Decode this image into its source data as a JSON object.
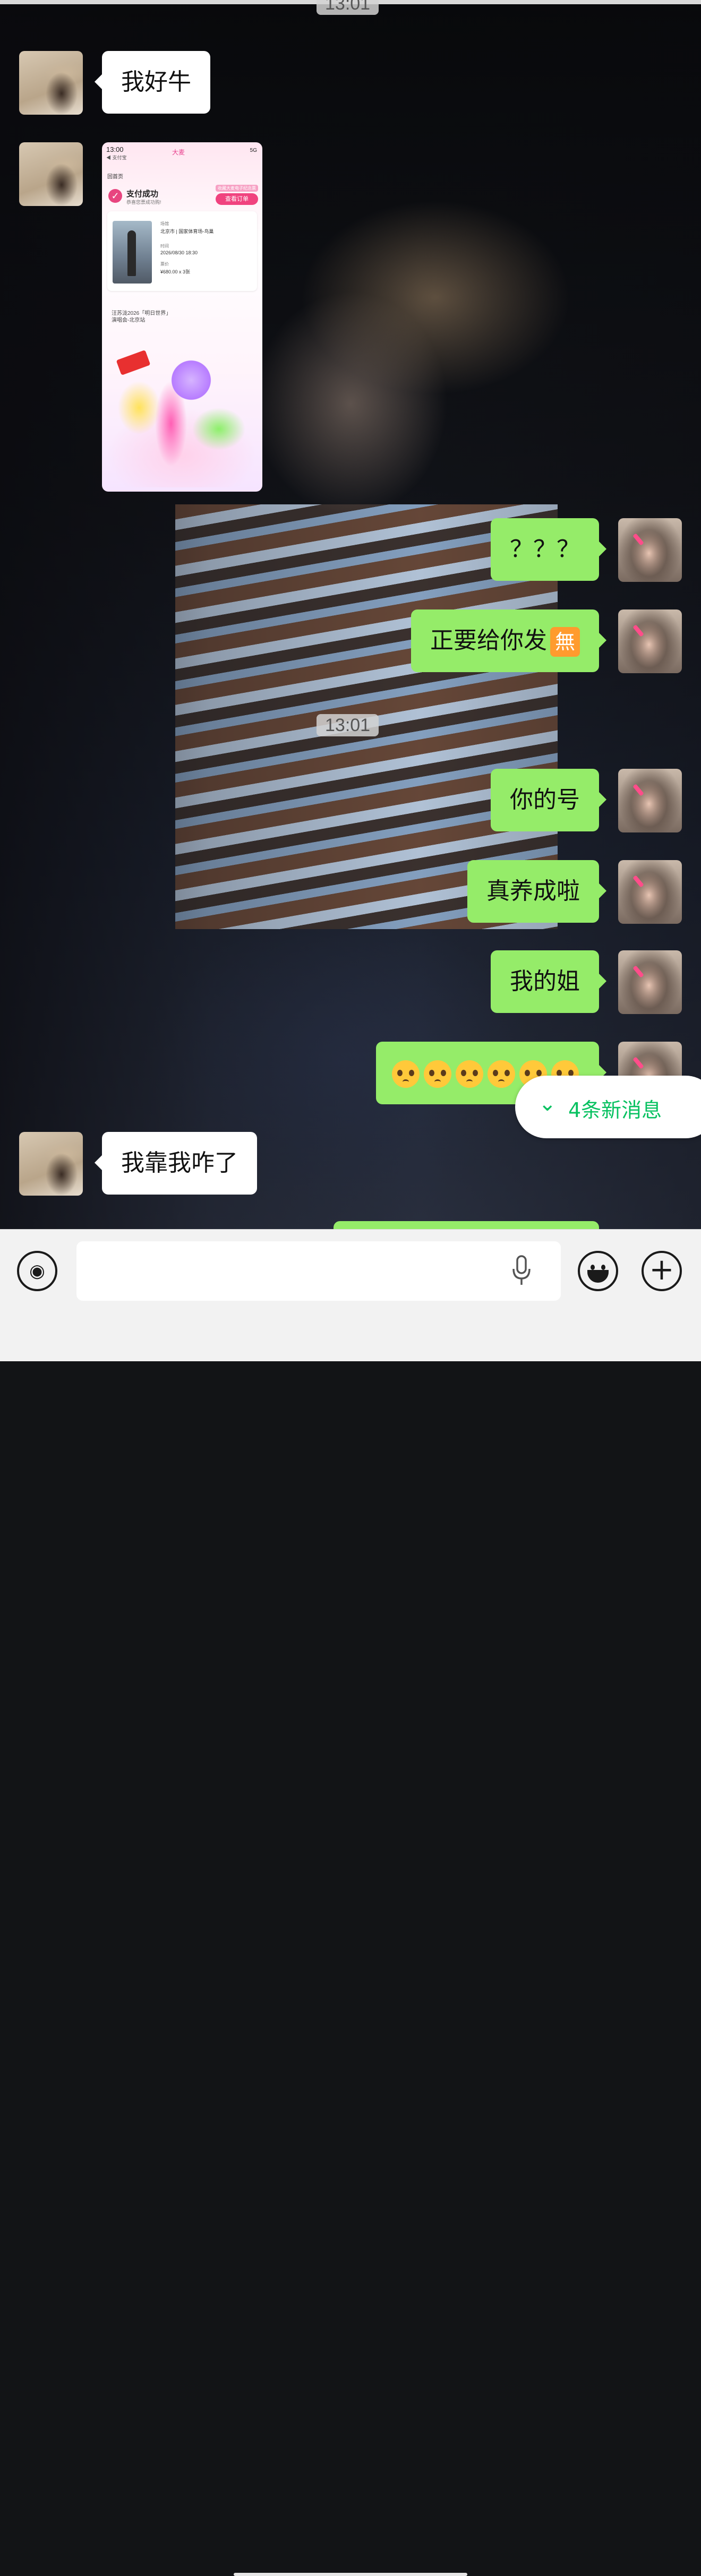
{
  "timestamps": [
    "13:01",
    "13:01"
  ],
  "messages": [
    {
      "side": "left",
      "text": "我好牛"
    },
    {
      "side": "left",
      "type": "image"
    },
    {
      "side": "right",
      "text": "？？？"
    },
    {
      "side": "right",
      "text": "正要给你发",
      "emoji": "無"
    },
    {
      "side": "right",
      "text": "你的号"
    },
    {
      "side": "right",
      "text": "真养成啦"
    },
    {
      "side": "right",
      "text": "我的姐"
    },
    {
      "side": "right",
      "type": "emoji-row",
      "emoji_count": 6,
      "emoji_name": "pleading-face"
    },
    {
      "side": "left",
      "text": "我靠我咋了"
    }
  ],
  "shared_screenshot": {
    "status_time": "13:00",
    "status_back": "◀ 支付宝",
    "brand": "大麦",
    "signal": "5G",
    "back_label": "回首页",
    "pay_title": "支付成功",
    "pay_sub": "恭喜您票成功购!",
    "tag": "收藏大麦电子纪念票",
    "order_button": "查看订单",
    "show_name": "汪苏泷2026「明日世界」演唱会-北京站",
    "venue_label": "场馆",
    "venue": "北京市 | 国家体育场-鸟巢",
    "time_label": "时间",
    "time": "2026/08/30 18:30",
    "price_label": "票价",
    "price": "¥680.00 x 3张"
  },
  "new_messages": {
    "label": "4条新消息",
    "icon": "double-chevron-down-icon"
  },
  "input_bar": {
    "voice_icon": "voice-icon",
    "mic_icon": "microphone-icon",
    "emoji_icon": "emoji-icon",
    "plus_icon": "plus-icon",
    "input_value": ""
  },
  "colors": {
    "bubble_right": "#95ec69",
    "bubble_left": "#ffffff",
    "accent": "#07c160"
  }
}
